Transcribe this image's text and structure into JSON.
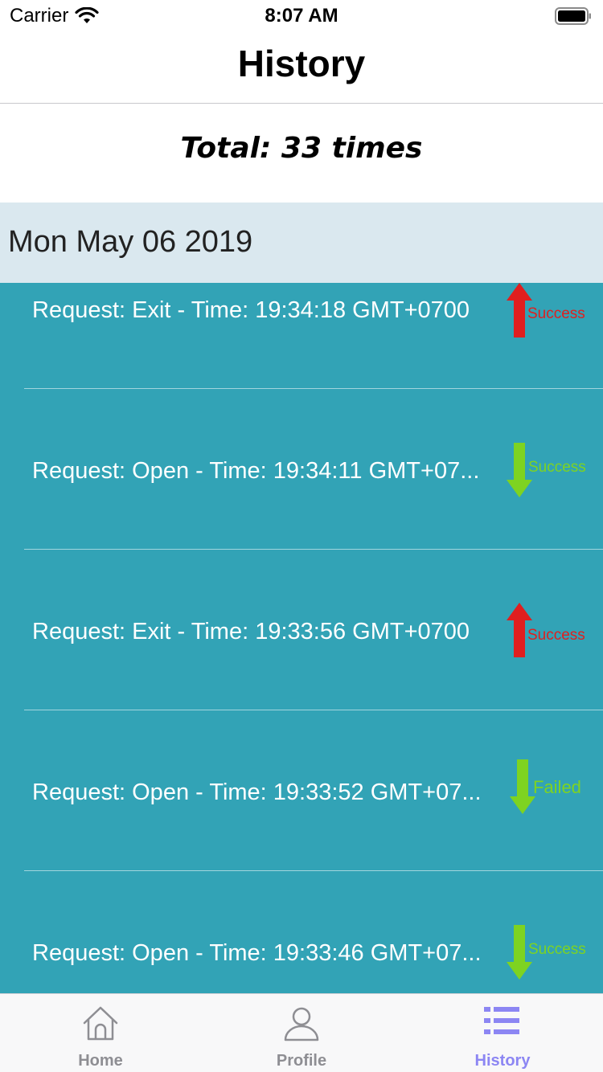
{
  "status_bar": {
    "carrier": "Carrier",
    "time": "8:07 AM"
  },
  "nav": {
    "title": "History"
  },
  "summary": {
    "total": "Total: 33 times"
  },
  "section": {
    "date": "Mon May 06 2019"
  },
  "colors": {
    "list_background": "#32a3b6",
    "section_background": "#dae8ef",
    "exit_arrow": "#e01f1f",
    "open_arrow": "#7ed321",
    "active_tab": "#8c86f3",
    "inactive_tab": "#8e8e93"
  },
  "history": [
    {
      "text": "Request: Exit - Time: 19:34:18 GMT+0700",
      "direction": "up",
      "status": "Success",
      "arrow_icon": "arrow-up-icon"
    },
    {
      "text": "Request: Open - Time: 19:34:11 GMT+07...",
      "direction": "down",
      "status": "Success",
      "arrow_icon": "arrow-down-icon"
    },
    {
      "text": "Request: Exit - Time: 19:33:56 GMT+0700",
      "direction": "up",
      "status": "Success",
      "arrow_icon": "arrow-up-icon"
    },
    {
      "text": "Request: Open - Time: 19:33:52 GMT+07...",
      "direction": "down",
      "status": "Failed",
      "arrow_icon": "arrow-down-icon"
    },
    {
      "text": "Request: Open - Time: 19:33:46 GMT+07...",
      "direction": "down",
      "status": "Success",
      "arrow_icon": "arrow-down-icon"
    }
  ],
  "tabs": [
    {
      "label": "Home",
      "icon": "home-icon",
      "active": false
    },
    {
      "label": "Profile",
      "icon": "profile-icon",
      "active": false
    },
    {
      "label": "History",
      "icon": "list-icon",
      "active": true
    }
  ]
}
